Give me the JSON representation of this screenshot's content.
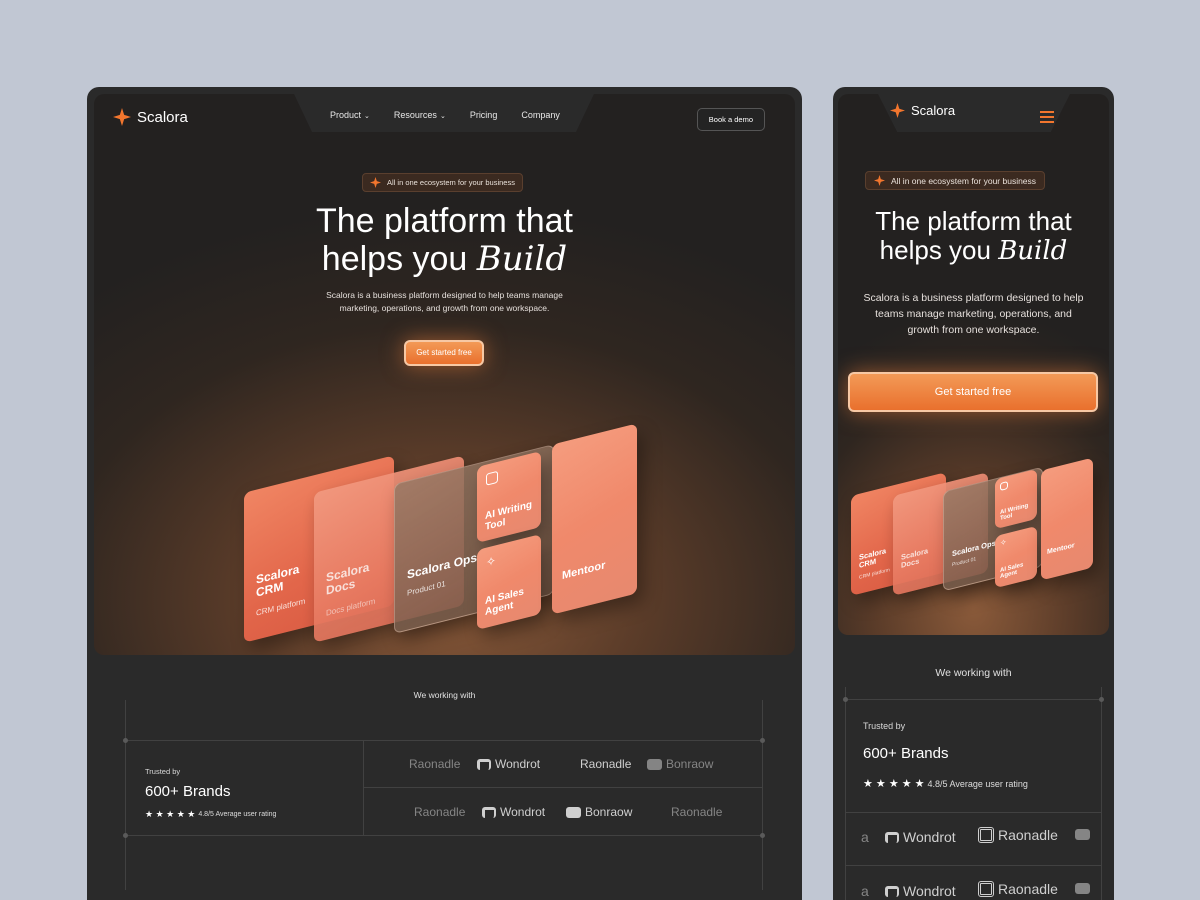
{
  "brand": {
    "name": "Scalora",
    "accent": "#f2762e"
  },
  "nav": {
    "links": [
      {
        "label": "Product",
        "has_menu": true
      },
      {
        "label": "Resources",
        "has_menu": true
      },
      {
        "label": "Pricing",
        "has_menu": false
      },
      {
        "label": "Company",
        "has_menu": false
      }
    ],
    "demo_button": "Book a demo",
    "chevron": "⌄"
  },
  "hero": {
    "pill": "All in one ecosystem for your business",
    "title_line1": "The platform that",
    "title_line2": "helps you",
    "title_italic": "Build",
    "subtitle_line1": "Scalora is a business platform designed to help teams manage",
    "subtitle_line2": "marketing, operations, and growth from one workspace.",
    "mobile_sub_1": "Scalora is a business platform designed to help",
    "mobile_sub_2": "teams manage marketing, operations, and",
    "mobile_sub_3": "growth from one workspace.",
    "cta": "Get started free"
  },
  "products": [
    {
      "name_1": "Scalora",
      "name_2": "CRM",
      "sub": "CRM platform"
    },
    {
      "name_1": "Scalora",
      "name_2": "Docs",
      "sub": "Docs platform"
    },
    {
      "name_1": "Scalora Ops",
      "sub": "Product 01"
    },
    {
      "name_1": "AI Writing",
      "name_2": "Tool"
    },
    {
      "name_1": "AI Sales",
      "name_2": "Agent"
    },
    {
      "name_1": "Mentoor"
    }
  ],
  "social": {
    "heading": "We working with",
    "trusted_label": "Trusted by",
    "brands_count": "600+ Brands",
    "stars": "★ ★ ★ ★ ★",
    "rating": "4.8/5 Average user rating",
    "row1": [
      "Raonadle",
      "Wondrot",
      "Raonadle",
      "Bonraow"
    ],
    "row2": [
      "Raonadle",
      "Wondrot",
      "Bonraow",
      "Raonadle"
    ],
    "mobile_rows": [
      [
        "a",
        "Wondrot",
        "Raonadle"
      ],
      [
        "a",
        "Wondrot",
        "Raonadle"
      ]
    ]
  }
}
